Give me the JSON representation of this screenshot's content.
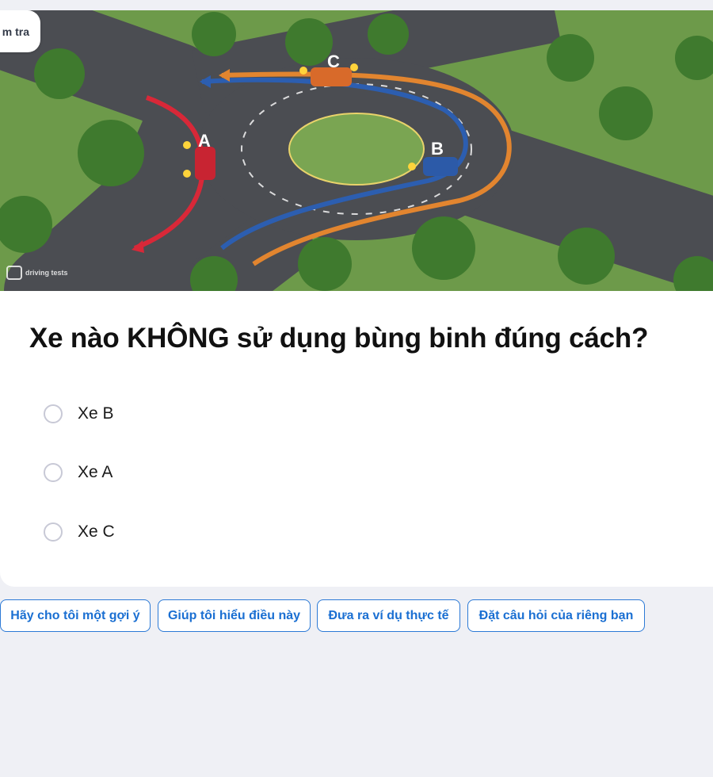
{
  "header": {
    "tab_label": "m tra"
  },
  "hero": {
    "alt": "Roundabout illustration",
    "car_labels": {
      "a": "A",
      "b": "B",
      "c": "C"
    },
    "watermark": "driving tests",
    "colors": {
      "grass": "#6d9a4a",
      "road": "#4b4d52",
      "red_path": "#d82838",
      "blue_path": "#2c5eb0",
      "orange_path": "#e2852f"
    }
  },
  "question": {
    "text": "Xe nào KHÔNG sử dụng bùng binh đúng cách?"
  },
  "options": [
    {
      "label": "Xe B",
      "selected": false
    },
    {
      "label": "Xe A",
      "selected": false
    },
    {
      "label": "Xe C",
      "selected": false
    }
  ],
  "assist": [
    "Hãy cho tôi một gợi ý",
    "Giúp tôi hiểu điều này",
    "Đưa ra ví dụ thực tế",
    "Đặt câu hỏi của riêng bạn"
  ],
  "theme": {
    "accent": "#1a6fd2",
    "page_bg": "#eff0f5"
  }
}
